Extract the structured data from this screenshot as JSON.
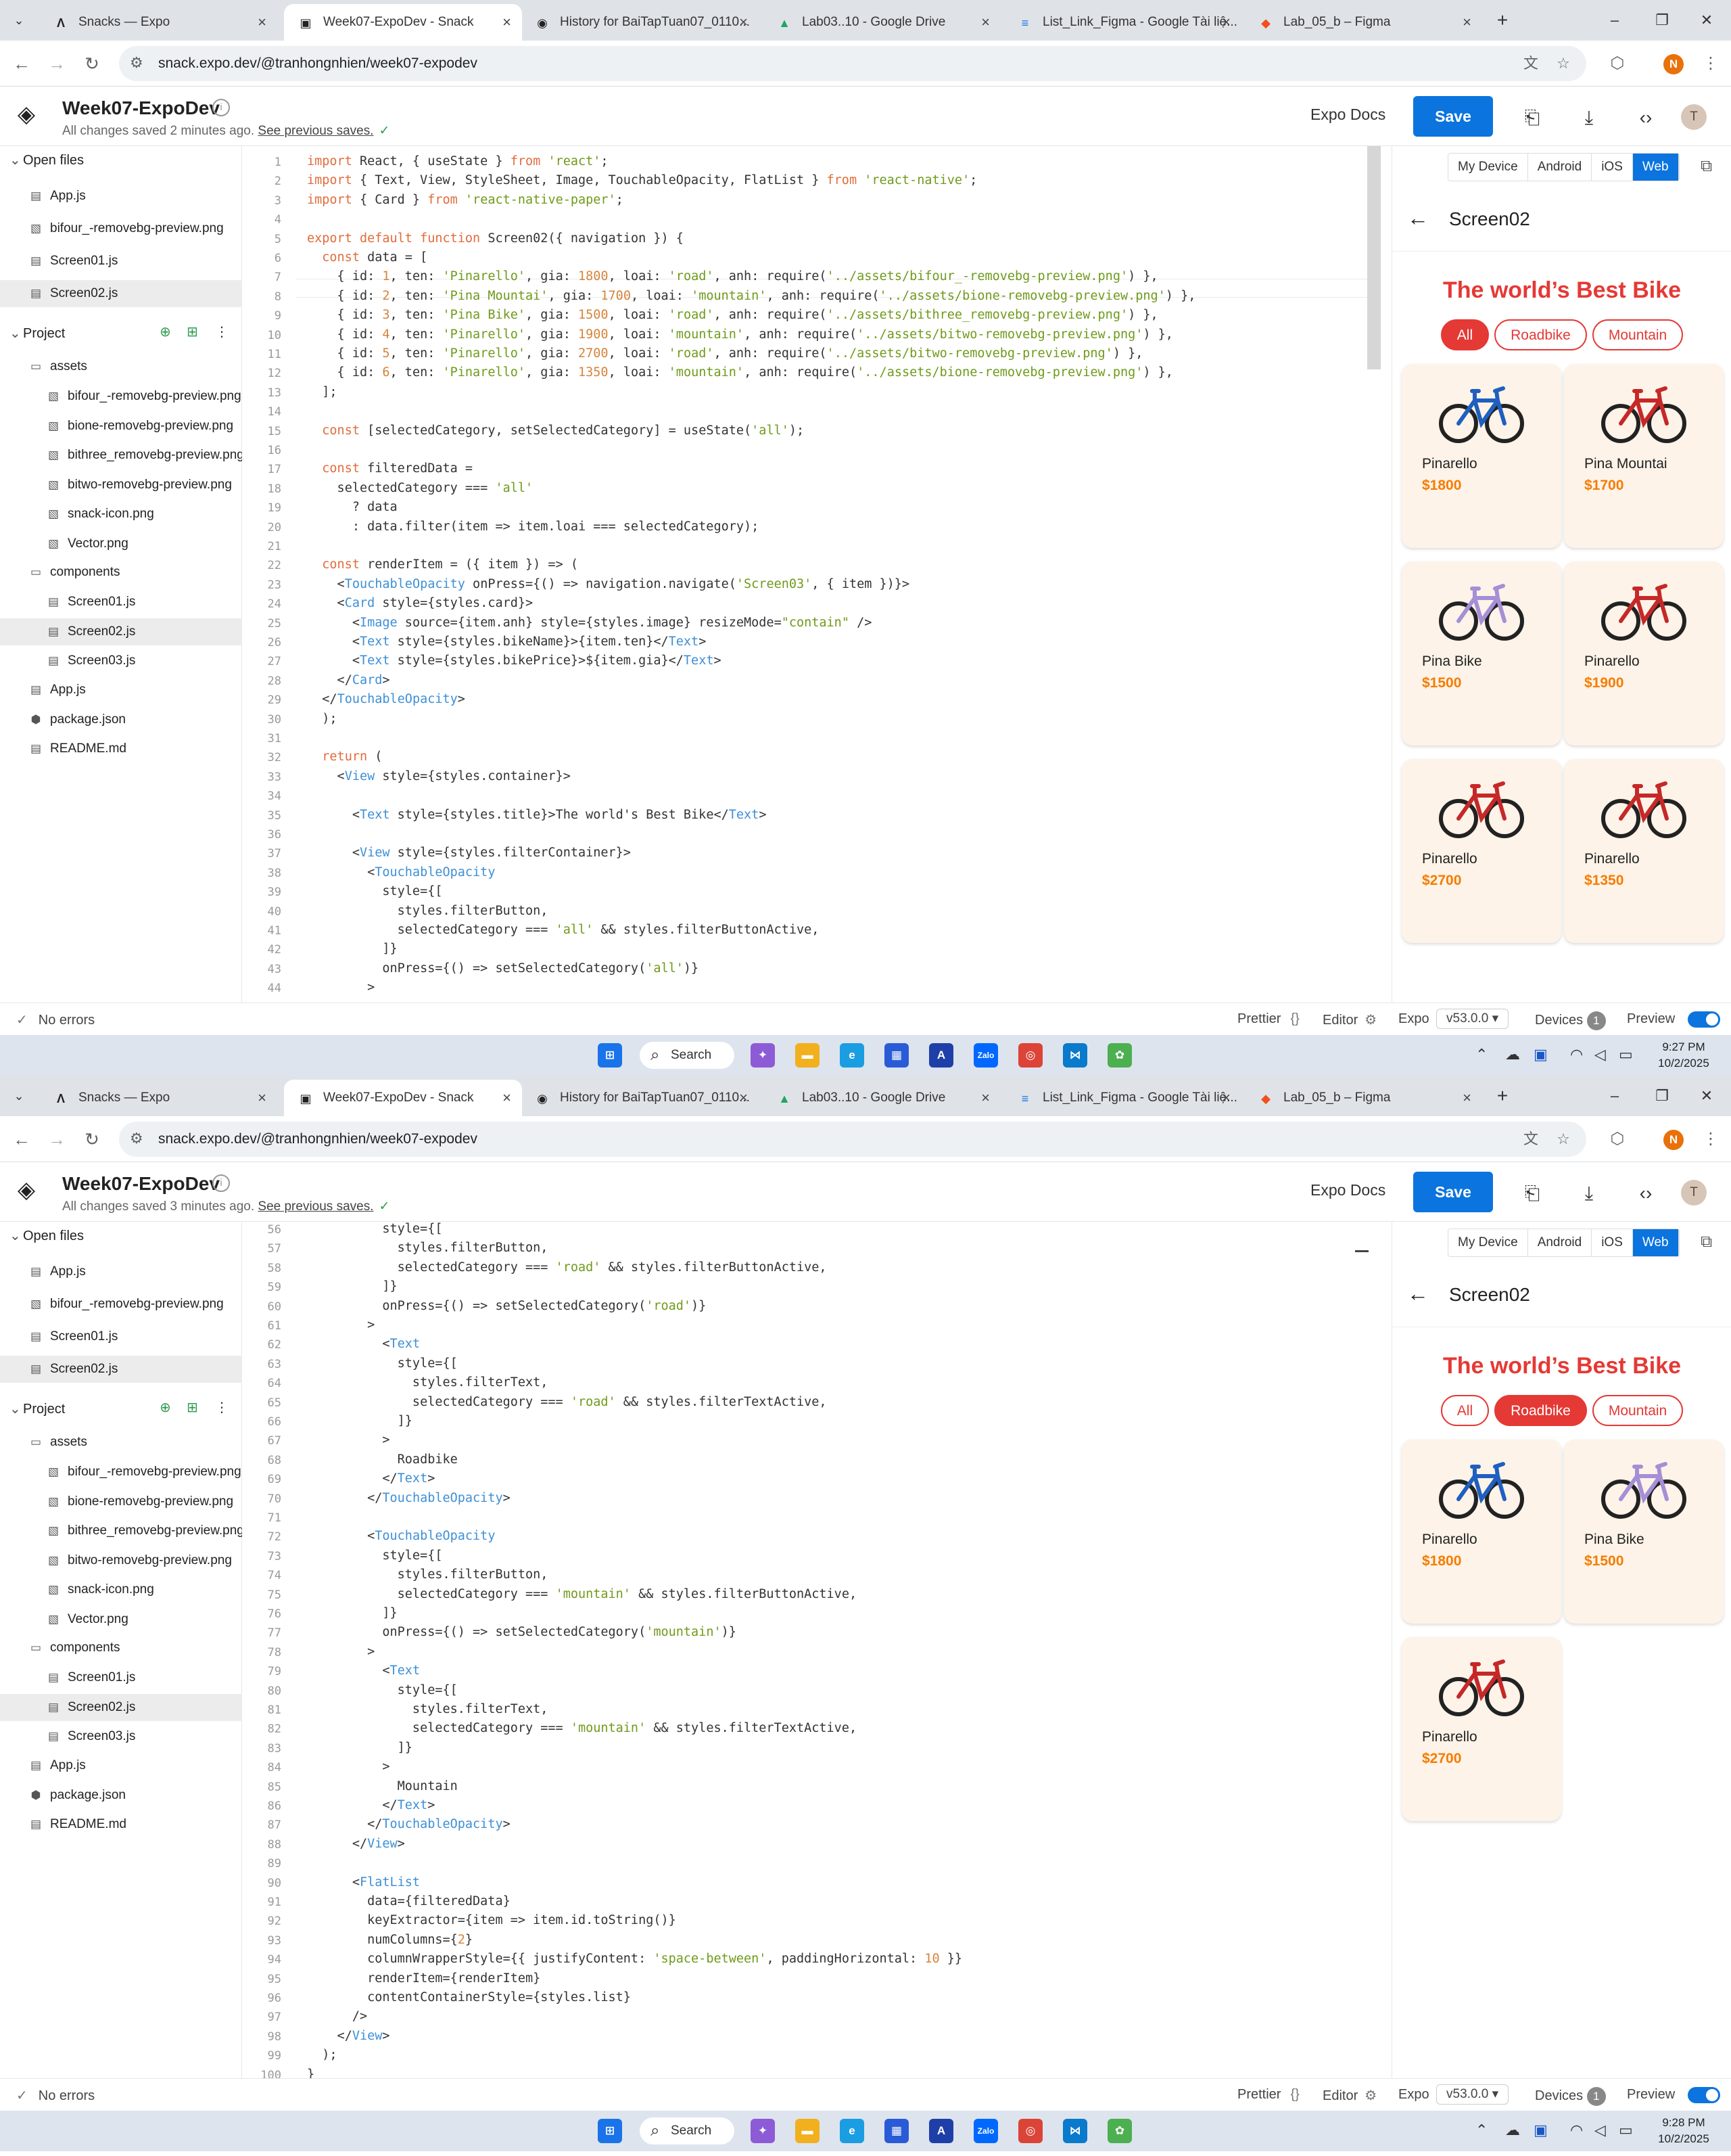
{
  "tabs": [
    {
      "label": "Snacks — Expo",
      "icon": "expo-icon"
    },
    {
      "label": "Week07-ExpoDev - Snack",
      "icon": "snack-icon"
    },
    {
      "label": "History for BaiTapTuan07_0110...",
      "icon": "github-icon"
    },
    {
      "label": "Lab03..10 - Google Drive",
      "icon": "drive-icon"
    },
    {
      "label": "List_Link_Figma - Google Tài liệ...",
      "icon": "docs-icon"
    },
    {
      "label": "Lab_05_b – Figma",
      "icon": "figma-icon"
    }
  ],
  "url": "snack.expo.dev/@tranhongnhien/week07-expodev",
  "profile_initial": "N",
  "header": {
    "project_name": "Week07-ExpoDev",
    "saved_prefix_1": "All changes saved 2 minutes ago.",
    "saved_prefix_2": "All changes saved 3 minutes ago.",
    "see_previous": "See previous saves.",
    "docs": "Expo Docs",
    "save": "Save",
    "avatar": "T"
  },
  "sidebar": {
    "open_files_title": "Open files",
    "open_files": [
      "App.js",
      "bifour_-removebg-preview.png",
      "Screen01.js",
      "Screen02.js"
    ],
    "project_title": "Project",
    "assets_folder": "assets",
    "assets": [
      "bifour_-removebg-preview.png",
      "bione-removebg-preview.png",
      "bithree_removebg-preview.png",
      "bitwo-removebg-preview.png",
      "snack-icon.png",
      "Vector.png"
    ],
    "components_folder": "components",
    "components": [
      "Screen01.js",
      "Screen02.js",
      "Screen03.js"
    ],
    "root_files": [
      "App.js",
      "package.json",
      "README.md"
    ]
  },
  "code1": [
    "import React, { useState } from 'react';",
    "import { Text, View, StyleSheet, Image, TouchableOpacity, FlatList } from 'react-native';",
    "import { Card } from 'react-native-paper';",
    "",
    "export default function Screen02({ navigation }) {",
    "  const data = [",
    "    { id: 1, ten: 'Pinarello', gia: 1800, loai: 'road', anh: require('../assets/bifour_-removebg-preview.png') },",
    "    { id: 2, ten: 'Pina Mountai', gia: 1700, loai: 'mountain', anh: require('../assets/bione-removebg-preview.png') },",
    "    { id: 3, ten: 'Pina Bike', gia: 1500, loai: 'road', anh: require('../assets/bithree_removebg-preview.png') },",
    "    { id: 4, ten: 'Pinarello', gia: 1900, loai: 'mountain', anh: require('../assets/bitwo-removebg-preview.png') },",
    "    { id: 5, ten: 'Pinarello', gia: 2700, loai: 'road', anh: require('../assets/bitwo-removebg-preview.png') },",
    "    { id: 6, ten: 'Pinarello', gia: 1350, loai: 'mountain', anh: require('../assets/bione-removebg-preview.png') },",
    "  ];",
    "",
    "  const [selectedCategory, setSelectedCategory] = useState('all');",
    "",
    "  const filteredData =",
    "    selectedCategory === 'all'",
    "      ? data",
    "      : data.filter(item => item.loai === selectedCategory);",
    "",
    "  const renderItem = ({ item }) => (",
    "    <TouchableOpacity onPress={() => navigation.navigate('Screen03', { item })}>",
    "    <Card style={styles.card}>",
    "      <Image source={item.anh} style={styles.image} resizeMode=\"contain\" />",
    "      <Text style={styles.bikeName}>{item.ten}</Text>",
    "      <Text style={styles.bikePrice}>${item.gia}</Text>",
    "    </Card>",
    "  </TouchableOpacity>",
    "  );",
    "",
    "  return (",
    "    <View style={styles.container}>",
    "",
    "      <Text style={styles.title}>The world's Best Bike</Text>",
    "",
    "      <View style={styles.filterContainer}>",
    "        <TouchableOpacity",
    "          style={[",
    "            styles.filterButton,",
    "            selectedCategory === 'all' && styles.filterButtonActive,",
    "          ]}",
    "          onPress={() => setSelectedCategory('all')}",
    "        >"
  ],
  "code2": [
    "          style={[",
    "            styles.filterButton,",
    "            selectedCategory === 'road' && styles.filterButtonActive,",
    "          ]}",
    "          onPress={() => setSelectedCategory('road')}",
    "        >",
    "          <Text",
    "            style={[",
    "              styles.filterText,",
    "              selectedCategory === 'road' && styles.filterTextActive,",
    "            ]}",
    "          >",
    "            Roadbike",
    "          </Text>",
    "        </TouchableOpacity>",
    "",
    "        <TouchableOpacity",
    "          style={[",
    "            styles.filterButton,",
    "            selectedCategory === 'mountain' && styles.filterButtonActive,",
    "          ]}",
    "          onPress={() => setSelectedCategory('mountain')}",
    "        >",
    "          <Text",
    "            style={[",
    "              styles.filterText,",
    "              selectedCategory === 'mountain' && styles.filterTextActive,",
    "            ]}",
    "          >",
    "            Mountain",
    "          </Text>",
    "        </TouchableOpacity>",
    "      </View>",
    "",
    "      <FlatList",
    "        data={filteredData}",
    "        keyExtractor={item => item.id.toString()}",
    "        numColumns={2}",
    "        columnWrapperStyle={{ justifyContent: 'space-between', paddingHorizontal: 10 }}",
    "        renderItem={renderItem}",
    "        contentContainerStyle={styles.list}",
    "      />",
    "    </View>",
    "  );",
    "}"
  ],
  "preview": {
    "devices": [
      "My Device",
      "Android",
      "iOS",
      "Web"
    ],
    "active_device": "Web",
    "screen_title": "Screen02",
    "app_title": "The world’s Best Bike",
    "filters": [
      "All",
      "Roadbike",
      "Mountain"
    ],
    "cards1": [
      {
        "name": "Pinarello",
        "price": "$1800",
        "color": "blue"
      },
      {
        "name": "Pina Mountai",
        "price": "$1700",
        "color": "red"
      },
      {
        "name": "Pina Bike",
        "price": "$1500",
        "color": "lavender"
      },
      {
        "name": "Pinarello",
        "price": "$1900",
        "color": "red"
      },
      {
        "name": "Pinarello",
        "price": "$2700",
        "color": "red"
      },
      {
        "name": "Pinarello",
        "price": "$1350",
        "color": "red"
      }
    ],
    "cards2": [
      {
        "name": "Pinarello",
        "price": "$1800",
        "color": "blue"
      },
      {
        "name": "Pina Bike",
        "price": "$1500",
        "color": "lavender"
      },
      {
        "name": "Pinarello",
        "price": "$2700",
        "color": "red"
      }
    ]
  },
  "footer": {
    "errors": "No errors",
    "prettier": "Prettier",
    "editor": "Editor",
    "expo": "Expo",
    "version": "v53.0.0 ▾",
    "devices": "Devices",
    "devices_count": "1",
    "preview": "Preview"
  },
  "taskbar": {
    "search": "Search",
    "time1": "9:27 PM",
    "date1": "10/2/2025",
    "time2": "9:28 PM",
    "date2": "10/2/2025"
  },
  "colors": {
    "accent": "#0b74de",
    "brand_red": "#e53935",
    "price": "#f57c00",
    "card_bg": "#fdf3e8"
  }
}
